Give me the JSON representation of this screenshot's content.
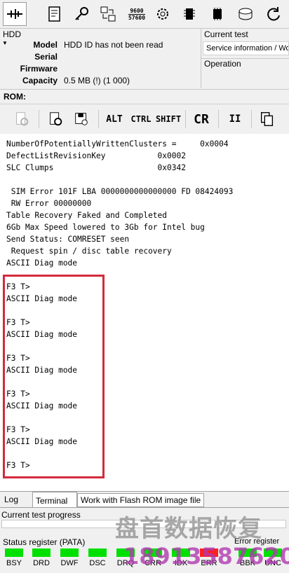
{
  "toolbar": {
    "icons": [
      "connect-icon",
      "script-icon",
      "key-icon",
      "transfer-icon",
      "speed-icon",
      "gear-icon",
      "chip-icon",
      "chip2-icon",
      "disk-icon",
      "refresh-icon"
    ],
    "speed_top": "9600",
    "speed_bottom": "57600"
  },
  "hdd": {
    "title": "HDD",
    "model_label": "Model",
    "model_value": "HDD ID has not been read",
    "serial_label": "Serial",
    "firmware_label": "Firmware",
    "capacity_label": "Capacity",
    "capacity_value": "0.5 MB (!) (1 000)"
  },
  "current_test": {
    "title": "Current test",
    "value": "Service information / Wo"
  },
  "operation": {
    "title": "Operation"
  },
  "rom": {
    "label": "ROM:"
  },
  "toolbar2": {
    "alt": "ALT",
    "ctrl": "CTRL",
    "shift": "SHIFT",
    "cr": "CR",
    "pause": "II"
  },
  "terminal": {
    "text": "NumberOfPotentiallyWrittenClusters =     0x0004\nDefectListRevisionKey           0x0002\nSLC Clumps                      0x0342\n\n SIM Error 101F LBA 0000000000000000 FD 08424093\n RW Error 00000000\nTable Recovery Faked and Completed\n6Gb Max Speed lowered to 3Gb for Intel bug\nSend Status: COMRESET seen\n Request spin / disc table recovery\nASCII Diag mode\n\nF3 T>\nASCII Diag mode\n\nF3 T>\nASCII Diag mode\n\nF3 T>\nASCII Diag mode\n\nF3 T>\nASCII Diag mode\n\nF3 T>\nASCII Diag mode\n\nF3 T>"
  },
  "tabs": {
    "log": "Log",
    "terminal": "Terminal",
    "flash": "Work with Flash ROM image file"
  },
  "progress": {
    "title": "Current test progress"
  },
  "status": {
    "title": "Status register (PATA)",
    "error_title": "Error register",
    "leds": [
      {
        "label": "BSY",
        "color": "#00e000"
      },
      {
        "label": "DRD",
        "color": "#00e000"
      },
      {
        "label": "DWF",
        "color": "#00e000"
      },
      {
        "label": "DSC",
        "color": "#00e000"
      },
      {
        "label": "DRQ",
        "color": "#00e000"
      },
      {
        "label": "CRR",
        "color": "#00e000"
      },
      {
        "label": "IDX",
        "color": "#00e000"
      },
      {
        "label": "ERR",
        "color": "#ff2020"
      }
    ],
    "error_leds": [
      {
        "label": "BBK",
        "color": "#00e000"
      },
      {
        "label": "UNC",
        "color": "#00e000"
      }
    ]
  },
  "watermark": {
    "line1": "盘首数据恢复",
    "line2": "18913587620"
  }
}
